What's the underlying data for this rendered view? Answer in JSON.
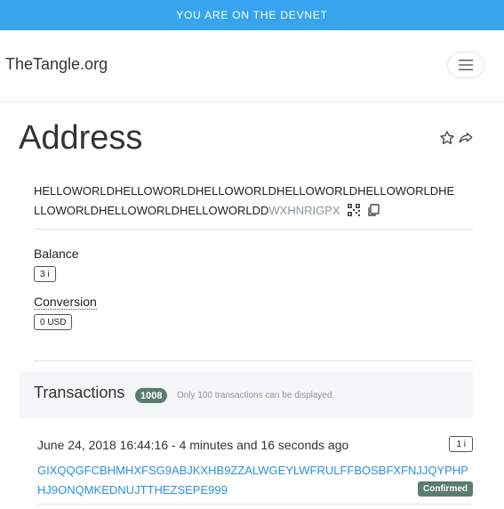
{
  "banner": {
    "text": "YOU ARE ON THE DEVNET",
    "color": "#37a4f0"
  },
  "navbar": {
    "brand": "TheTangle.org",
    "menu_icon": "hamburger-icon"
  },
  "page": {
    "title": "Address",
    "actions": [
      "star-icon",
      "share-icon"
    ]
  },
  "address": {
    "main": "HELLOWORLDHELLOWORLDHELLOWORLDHELLOWORLDHELLOWORLDHELLOWORLDHELLOWORLDHELLOWORLDD",
    "checksum": "WXHNRIGPX",
    "icons": [
      "qr-code-icon",
      "copy-icon"
    ]
  },
  "balance": {
    "label": "Balance",
    "value": "3 i"
  },
  "conversion": {
    "label": "Conversion",
    "value": "0 USD"
  },
  "transactions": {
    "title": "Transactions",
    "count": "1008",
    "note": "Only 100 transactions can be displayed.",
    "items": [
      {
        "time": "June 24, 2018 16:44:16 - 4 minutes and 16 seconds ago",
        "value": "1 i",
        "hash": "GIXQQGFCBHMHXFSG9ABJKXHB9ZZALWGEYLWFRULFFBOSBFXFNJJQYPHPHJ9ONQMKEDNUJTTHEZSEPE999",
        "status": "Confirmed"
      }
    ]
  },
  "colors": {
    "accent": "#2d8fe0",
    "confirmed": "#5a7d6c"
  }
}
